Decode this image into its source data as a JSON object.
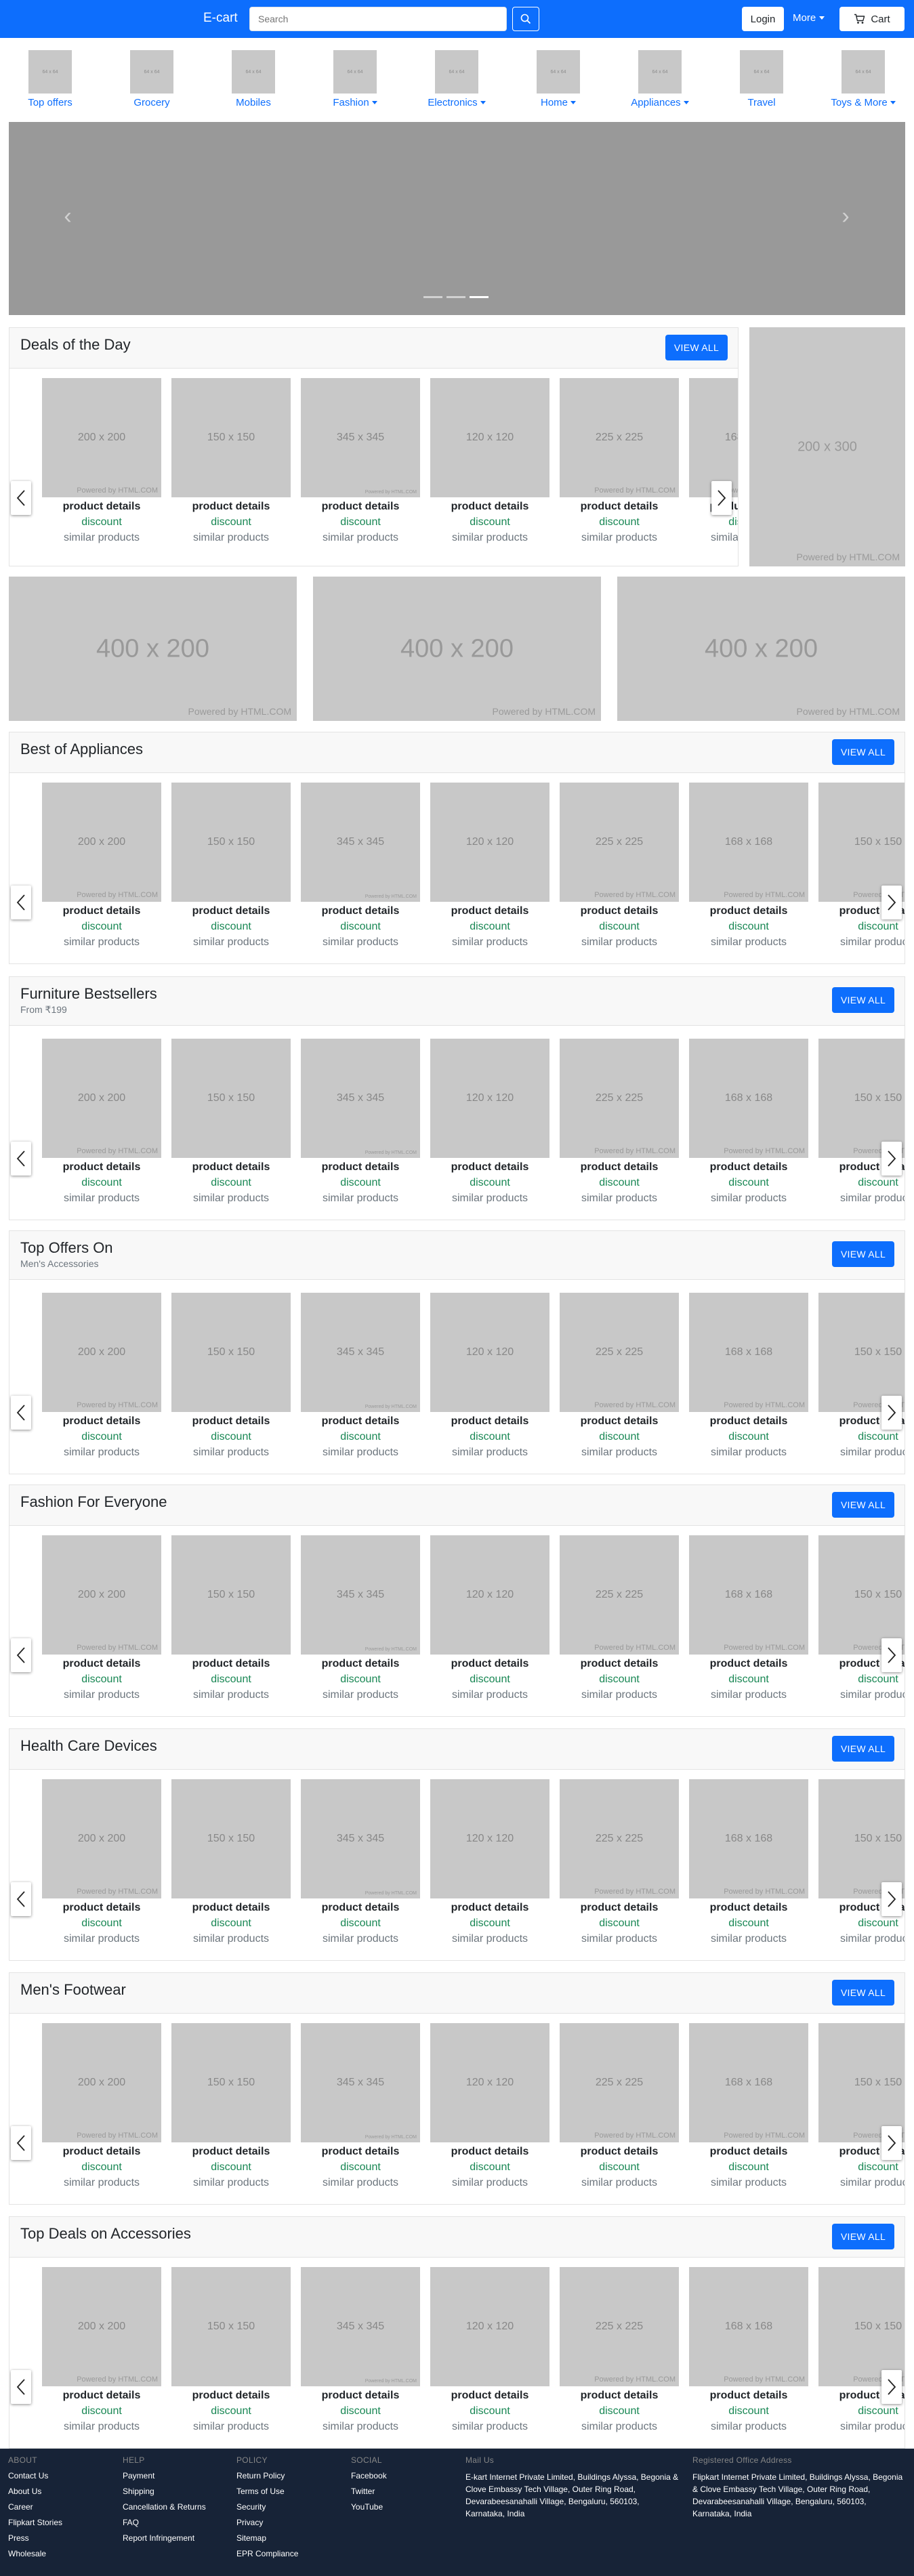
{
  "header": {
    "brand": "E-cart",
    "search_placeholder": "Search",
    "login_label": "Login",
    "more_label": "More",
    "cart_label": "Cart",
    "accent_color": "#0d6efd"
  },
  "categories": [
    {
      "label": "Top offers",
      "img_text": "64 x 64"
    },
    {
      "label": "Grocery",
      "img_text": "64 x 64"
    },
    {
      "label": "Mobiles",
      "img_text": "64 x 64"
    },
    {
      "label": "Fashion",
      "img_text": "64 x 64"
    },
    {
      "label": "Electronics",
      "img_text": "64 x 64"
    },
    {
      "label": "Home",
      "img_text": "64 x 64"
    },
    {
      "label": "Appliances",
      "img_text": "64 x 64"
    },
    {
      "label": "Travel",
      "img_text": "64 x 64"
    },
    {
      "label": "Toys & More",
      "img_text": "64 x 64"
    }
  ],
  "carousel": {
    "slide_count": 3,
    "active_slide": 3
  },
  "card": {
    "name": "product details",
    "discount": "discount",
    "similar": "similar products",
    "powered": "Powered by HTML.COM"
  },
  "card_images": [
    "200 x 200",
    "150 x 150",
    "345 x 345",
    "120 x 120",
    "225 x 225",
    "168 x 168",
    "150 x 150"
  ],
  "deals": {
    "title": "Deals of the Day",
    "view_all": "VIEW ALL"
  },
  "side_ad": {
    "text": "200 x 300",
    "powered": "Powered by HTML.COM"
  },
  "banners": [
    {
      "text": "400 x 200",
      "powered": "Powered by HTML.COM"
    },
    {
      "text": "400 x 200",
      "powered": "Powered by HTML.COM"
    },
    {
      "text": "400 x 200",
      "powered": "Powered by HTML.COM"
    }
  ],
  "sections": [
    {
      "title": "Best of Appliances",
      "subtitle": "",
      "view_all": "VIEW ALL"
    },
    {
      "title": "Furniture Bestsellers",
      "subtitle": "From ₹199",
      "view_all": "VIEW ALL"
    },
    {
      "title": "Top Offers On",
      "subtitle": "Men's Accessories",
      "view_all": "VIEW ALL"
    },
    {
      "title": "Fashion For Everyone",
      "subtitle": "",
      "view_all": "VIEW ALL"
    },
    {
      "title": "Health Care Devices",
      "subtitle": "",
      "view_all": "VIEW ALL"
    },
    {
      "title": "Men's Footwear",
      "subtitle": "",
      "view_all": "VIEW ALL"
    },
    {
      "title": "Top Deals on Accessories",
      "subtitle": "",
      "view_all": "VIEW ALL"
    }
  ],
  "footer": {
    "about": {
      "heading": "ABOUT",
      "links": [
        "Contact Us",
        "About Us",
        "Career",
        "Flipkart Stories",
        "Press",
        "Wholesale"
      ]
    },
    "help": {
      "heading": "HELP",
      "links": [
        "Payment",
        "Shipping",
        "Cancellation & Returns",
        "FAQ",
        "Report Infringement"
      ]
    },
    "policy": {
      "heading": "POLICY",
      "links": [
        "Return Policy",
        "Terms of Use",
        "Security",
        "Privacy",
        "Sitemap",
        "EPR Compliance"
      ]
    },
    "social": {
      "heading": "SOCIAL",
      "links": [
        "Facebook",
        "Twitter",
        "YouTube"
      ]
    },
    "mail": {
      "heading": "Mail Us",
      "text": "E-kart Internet Private Limited, Buildings Alyssa, Begonia & Clove Embassy Tech Village, Outer Ring Road, Devarabeesanahalli Village, Bengaluru, 560103, Karnataka, India"
    },
    "office": {
      "heading": "Registered Office Address",
      "text": "Flipkart Internet Private Limited, Buildings Alyssa, Begonia & Clove Embassy Tech Village, Outer Ring Road, Devarabeesanahalli Village, Bengaluru, 560103, Karnataka, India"
    }
  }
}
